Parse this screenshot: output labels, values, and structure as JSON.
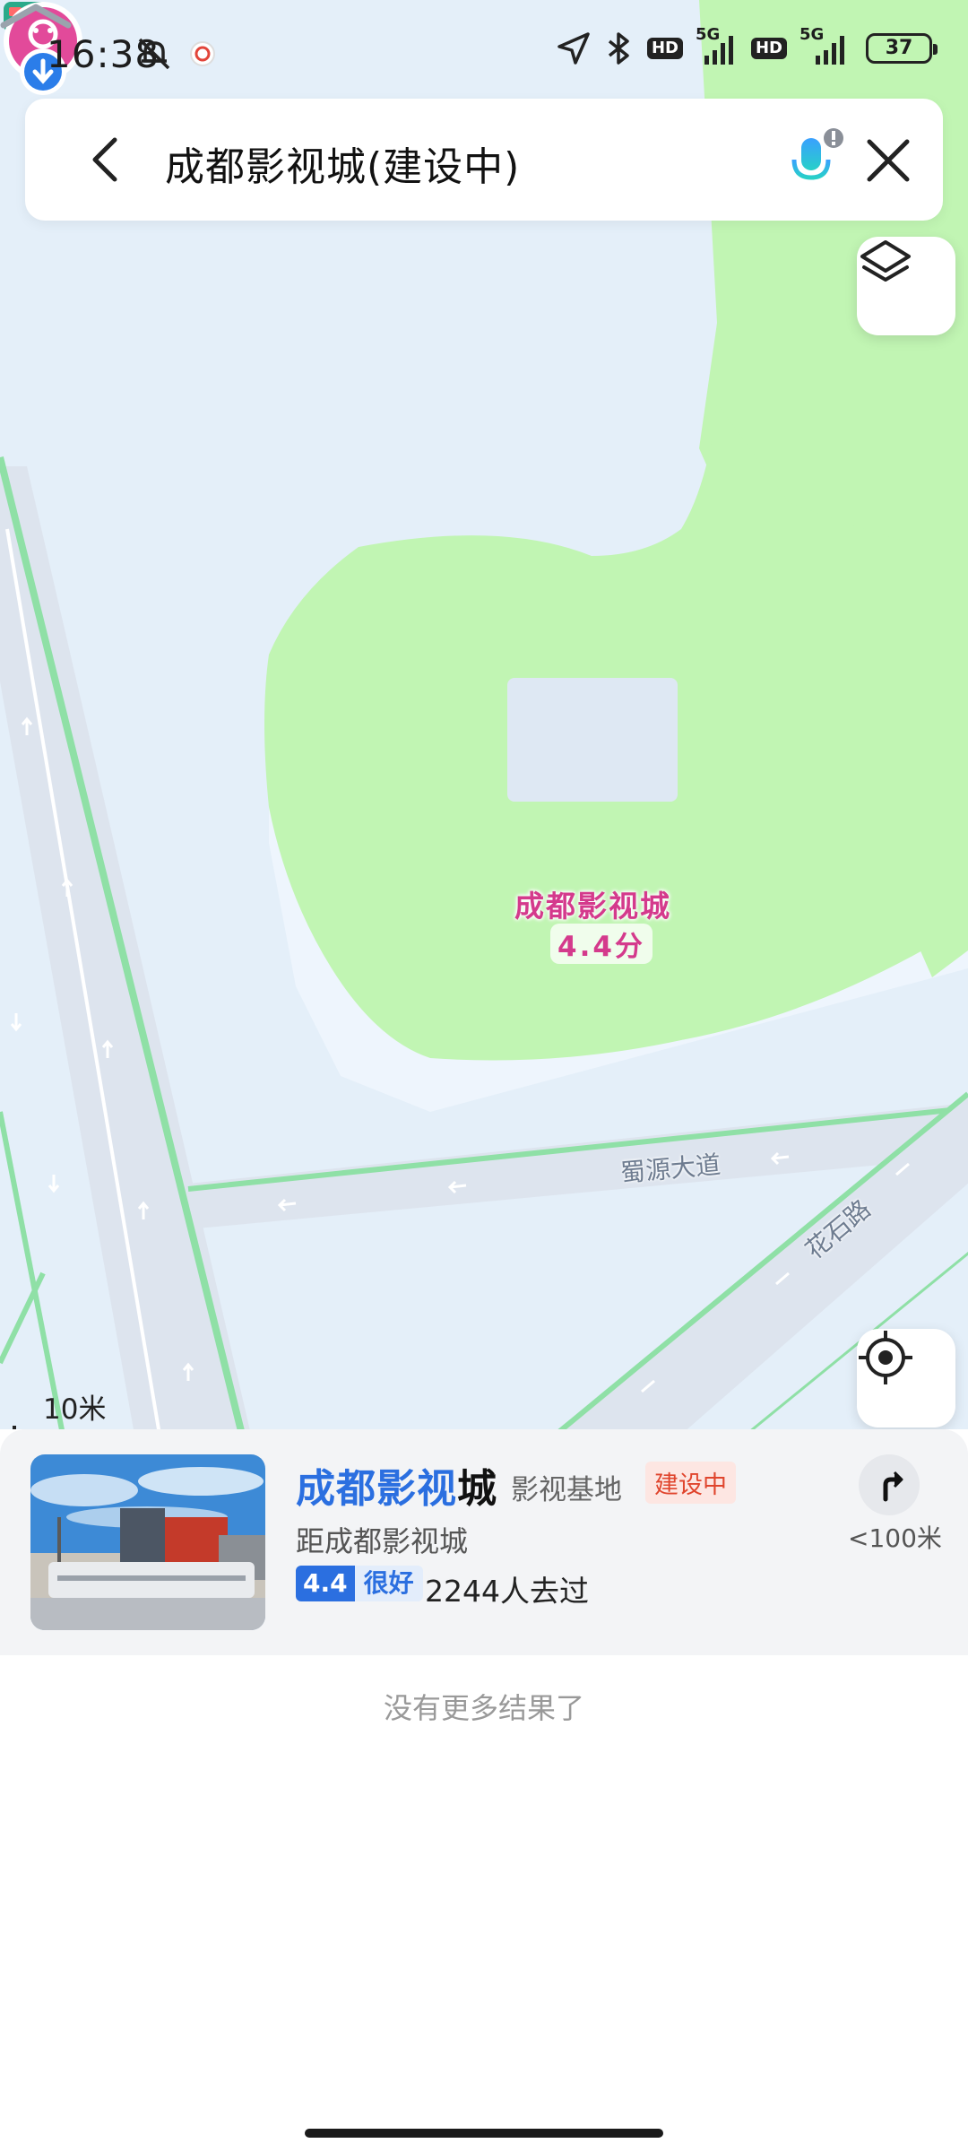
{
  "status_bar": {
    "time": "16:38",
    "battery": "37",
    "network_1": "5G",
    "network_2": "5G",
    "hd_1": "HD",
    "hd_2": "HD",
    "icons": [
      "bell-muted-icon",
      "app-notification-icon",
      "location-arrow-icon",
      "bluetooth-icon",
      "signal-icon",
      "battery-icon"
    ]
  },
  "search": {
    "query": "成都影视城(建设中)",
    "icons": [
      "back-arrow-icon",
      "microphone-icon",
      "close-icon"
    ]
  },
  "map": {
    "poi_name": "成都影视城",
    "poi_score": "4.4分",
    "roads": [
      "蜀源大道",
      "花石路"
    ],
    "scale": "10米",
    "colors": {
      "background": "#eef5fd",
      "green_area": "#c1f5b3",
      "road": "#dde4ee",
      "road_edge": "#8fe0a6",
      "poi": "#e24a9a",
      "pin_blue": "#2b7de9"
    }
  },
  "result": {
    "title_highlight": "成都影视",
    "title_rest": "城",
    "category": "影视基地",
    "status": "建设中",
    "distance_desc": "距成都影视城",
    "rating_score": "4.4",
    "rating_text": "很好",
    "visited": "2244人去过",
    "nav_distance": "<100米"
  },
  "footer": {
    "no_more": "没有更多结果了"
  }
}
